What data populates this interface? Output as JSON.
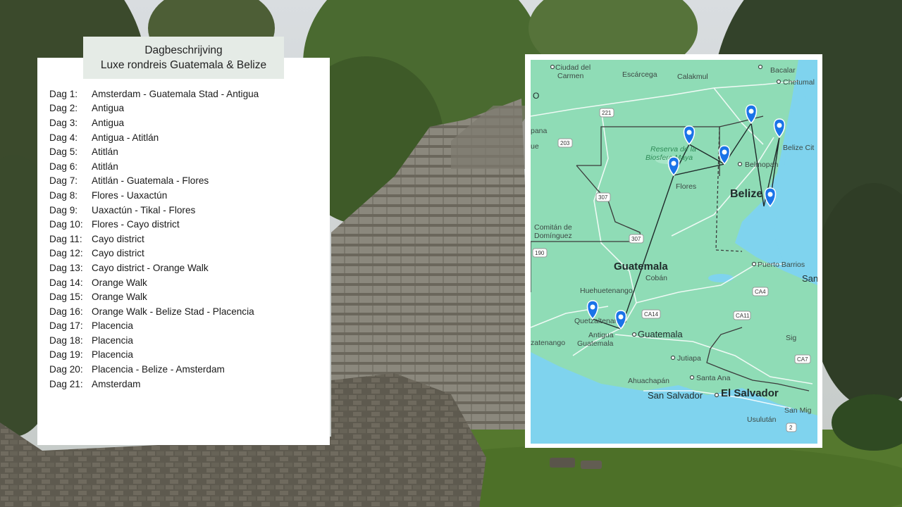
{
  "title": {
    "line1": "Dagbeschrijving",
    "line2": "Luxe rondreis Guatemala & Belize"
  },
  "itinerary": [
    {
      "day": "Dag 1:",
      "route": "Amsterdam - Guatemala Stad - Antigua"
    },
    {
      "day": "Dag 2:",
      "route": "Antigua"
    },
    {
      "day": "Dag 3:",
      "route": "Antigua"
    },
    {
      "day": "Dag 4:",
      "route": "Antigua - Atitlán"
    },
    {
      "day": "Dag 5:",
      "route": "Atitlán"
    },
    {
      "day": "Dag 6:",
      "route": "Atitlán"
    },
    {
      "day": "Dag 7:",
      "route": "Atitlán - Guatemala - Flores"
    },
    {
      "day": "Dag 8:",
      "route": "Flores - Uaxactún"
    },
    {
      "day": "Dag 9:",
      "route": "Uaxactún - Tikal - Flores"
    },
    {
      "day": "Dag 10:",
      "route": "Flores - Cayo district"
    },
    {
      "day": "Dag 11:",
      "route": "Cayo district"
    },
    {
      "day": "Dag 12:",
      "route": "Cayo district"
    },
    {
      "day": "Dag 13:",
      "route": "Cayo district - Orange Walk"
    },
    {
      "day": "Dag 14:",
      "route": "Orange Walk"
    },
    {
      "day": "Dag 15:",
      "route": "Orange Walk"
    },
    {
      "day": "Dag 16:",
      "route": "Orange Walk - Belize Stad - Placencia"
    },
    {
      "day": "Dag 17:",
      "route": "Placencia"
    },
    {
      "day": "Dag 18:",
      "route": "Placencia"
    },
    {
      "day": "Dag 19:",
      "route": "Placencia"
    },
    {
      "day": "Dag 20:",
      "route": "Placencia - Belize - Amsterdam"
    },
    {
      "day": "Dag 21:",
      "route": "Amsterdam"
    }
  ],
  "map": {
    "labels": {
      "ciudad_del": "Ciudad del",
      "carmen": "Carmen",
      "escarcega": "Escárcega",
      "calakmul": "Calakmul",
      "bacalar": "Bacalar",
      "chetumal": "Chetumal",
      "pana": "pana",
      "ue": "ue",
      "reserva": "Reserva de la",
      "biosfera": "Biosfera Maya",
      "belize_city": "Belize Cit",
      "belmopan": "Belmopan",
      "belize": "Belize",
      "flores": "Flores",
      "comitan": "Comitán de",
      "dominguez": "Domínguez",
      "guatemala_country": "Guatemala",
      "puerto_barrios": "Puerto Barrios",
      "san_p": "San P",
      "huehuetenango": "Huehuetenango",
      "coban": "Cobán",
      "quetzaltenango": "Quetzaltenango",
      "antigua": "Antigua",
      "antigua_guatemala": "Guatemala",
      "guatemala_city": "Guatemala",
      "zatenango": "zatenango",
      "jutiapa": "Jutiapa",
      "sig": "Sig",
      "ahuachapan": "Ahuachapán",
      "santa_ana": "Santa Ana",
      "san_salvador": "San Salvador",
      "el_salvador": "El Salvador",
      "san_mig": "San Mig",
      "usulutan": "Usulután",
      "o": "O"
    },
    "shields": {
      "r221": "221",
      "r203": "203",
      "r307a": "307",
      "r307b": "307",
      "r190": "190",
      "ca14": "CA14",
      "ca4": "CA4",
      "ca11": "CA11",
      "ca7": "CA7",
      "r2": "2"
    },
    "colors": {
      "land": "#8fdcb6",
      "water": "#7fd3ee",
      "pin": "#1a73e8",
      "route": "#1f2a2a"
    }
  }
}
